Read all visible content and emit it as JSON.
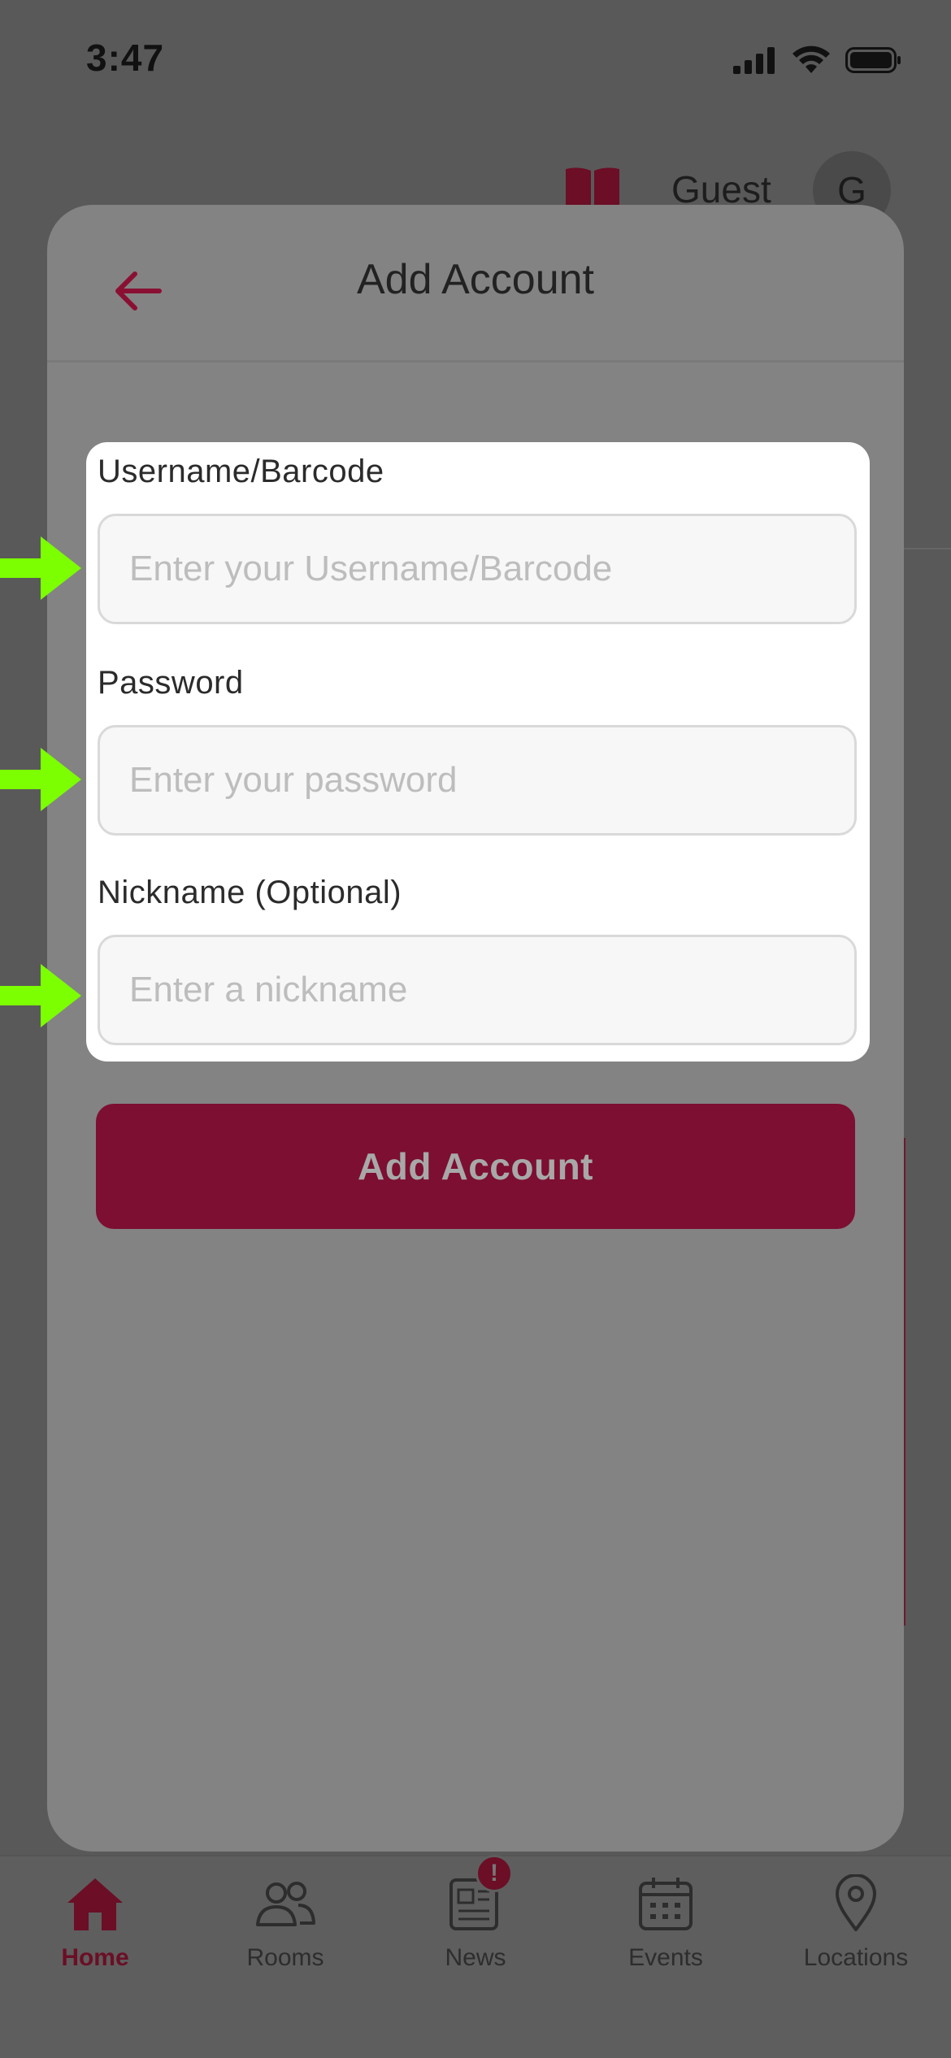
{
  "status_bar": {
    "time": "3:47"
  },
  "background": {
    "header_user": "Guest",
    "avatar_initial": "G"
  },
  "sheet": {
    "title": "Add Account",
    "back_icon": "arrow-left-icon"
  },
  "form": {
    "username": {
      "label": "Username/Barcode",
      "placeholder": "Enter your Username/Barcode",
      "value": ""
    },
    "password": {
      "label": "Password",
      "placeholder": "Enter your password",
      "value": ""
    },
    "nickname": {
      "label": "Nickname (Optional)",
      "placeholder": "Enter a nickname",
      "value": ""
    },
    "submit_label": "Add Account"
  },
  "tab_bar": {
    "items": [
      {
        "label": "Home",
        "icon": "home-icon",
        "active": true
      },
      {
        "label": "Rooms",
        "icon": "people-icon",
        "active": false
      },
      {
        "label": "News",
        "icon": "newspaper-icon",
        "active": false,
        "badge": "!"
      },
      {
        "label": "Events",
        "icon": "calendar-icon",
        "active": false
      },
      {
        "label": "Locations",
        "icon": "map-pin-icon",
        "active": false
      }
    ]
  },
  "colors": {
    "accent": "#7c0f32",
    "overlay": "#595959",
    "annotation_arrow": "#7cff00"
  }
}
